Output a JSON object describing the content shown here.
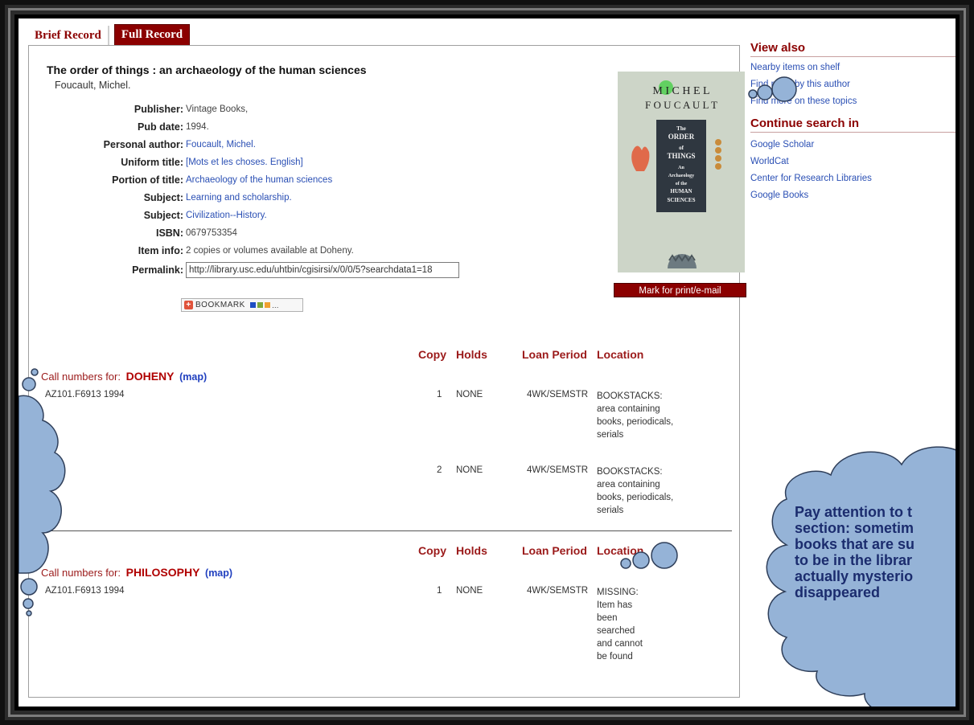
{
  "tabs": {
    "brief": "Brief Record",
    "full": "Full Record"
  },
  "record": {
    "title": "The order of things : an archaeology of the human sciences",
    "author": "Foucault, Michel.",
    "fields": [
      {
        "label": "Publisher:",
        "value": "Vintage Books,",
        "link": false
      },
      {
        "label": "Pub date:",
        "value": "1994.",
        "link": false
      },
      {
        "label": "Personal author:",
        "value": "Foucault, Michel.",
        "link": true
      },
      {
        "label": "Uniform title:",
        "value": "[Mots et les choses. English]",
        "link": true
      },
      {
        "label": "Portion of title:",
        "value": "Archaeology of the human sciences",
        "link": true
      },
      {
        "label": "Subject:",
        "value": "Learning and scholarship.",
        "link": true
      },
      {
        "label": "Subject:",
        "value": "Civilization--History.",
        "link": true
      },
      {
        "label": "ISBN:",
        "value": "0679753354",
        "link": false
      },
      {
        "label": "Item info:",
        "value": "2 copies or volumes available at Doheny.",
        "link": false
      }
    ],
    "permalink_label": "Permalink:",
    "permalink_value": "http://library.usc.edu/uhtbin/cgisirsi/x/0/0/5?searchdata1=18",
    "bookmark_label": "BOOKMARK",
    "mark_button": "Mark for print/e-mail"
  },
  "cover": {
    "author_line1": "M I C H E L",
    "author_line2": "F O U C A U L T",
    "title_lines": [
      "The",
      "ORDER",
      "of",
      "THINGS",
      "An",
      "Archaeology",
      "of the",
      "HUMAN",
      "SCIENCES"
    ]
  },
  "holdings_headers": {
    "copy": "Copy",
    "holds": "Holds",
    "loan": "Loan Period",
    "location": "Location"
  },
  "holdings": [
    {
      "prefix": "Call numbers for:",
      "library": "DOHENY",
      "map": "(map)",
      "items": [
        {
          "callnumber": "AZ101.F6913 1994",
          "copy": "1",
          "holds": "NONE",
          "loan": "4WK/SEMSTR",
          "location": "BOOKSTACKS: area containing books, periodicals, serials"
        },
        {
          "callnumber": "",
          "copy": "2",
          "holds": "NONE",
          "loan": "4WK/SEMSTR",
          "location": "BOOKSTACKS: area containing books, periodicals, serials"
        }
      ]
    },
    {
      "prefix": "Call numbers for:",
      "library": "PHILOSOPHY",
      "map": "(map)",
      "items": [
        {
          "callnumber": "AZ101.F6913 1994",
          "copy": "1",
          "holds": "NONE",
          "loan": "4WK/SEMSTR",
          "location": "MISSING: Item has been searched and cannot be found"
        }
      ]
    }
  ],
  "sidebar": {
    "view_also": {
      "heading": "View also",
      "links": [
        "Nearby items on shelf",
        "Find more by this author",
        "Find more on these topics"
      ]
    },
    "continue": {
      "heading": "Continue search in",
      "links": [
        "Google Scholar",
        "WorldCat",
        "Center for Research Libraries",
        "Google Books"
      ]
    }
  },
  "callout": {
    "text": "Pay attention to t\nsection: sometim\nbooks  that are su\nto be in the librar\nactually mysterio\ndisappeared"
  },
  "colors": {
    "maroon": "#8b0000",
    "link_blue": "#2a4fb4",
    "bubble_fill": "#95b3d7",
    "bubble_stroke": "#2f3f5a"
  }
}
